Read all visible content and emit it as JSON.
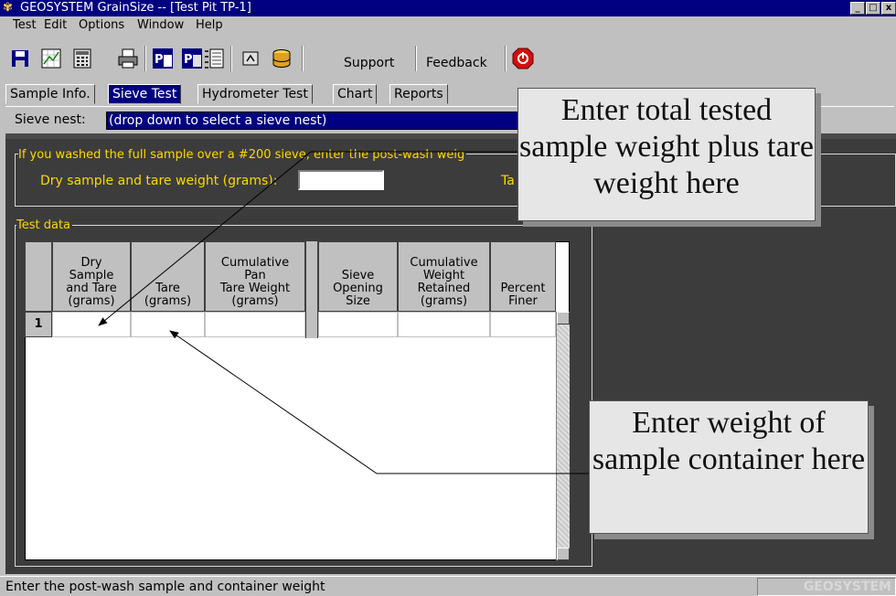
{
  "window": {
    "title": "GEOSYSTEM GrainSize -- [Test Pit TP-1]",
    "controls": [
      "_",
      "□",
      "x"
    ]
  },
  "menu": [
    {
      "label": "Test"
    },
    {
      "label": "Edit"
    },
    {
      "label": "Options"
    },
    {
      "label": "Window"
    },
    {
      "label": "Help"
    }
  ],
  "toolbar": {
    "icons": [
      "save-icon",
      "chart-icon",
      "calculator-icon",
      "printer-icon",
      "report-icon",
      "report-alt-icon",
      "sieve-icon",
      "edit-icon",
      "database-icon"
    ],
    "support_label": "Support",
    "feedback_label": "Feedback",
    "exit_icon": "stop-icon"
  },
  "tabs": [
    {
      "label": "Sample Info.",
      "active": false
    },
    {
      "label": "Sieve Test",
      "active": true
    },
    {
      "label": "Hydrometer Test",
      "active": false
    },
    {
      "label": "Chart",
      "active": false
    },
    {
      "label": "Reports",
      "active": false
    }
  ],
  "sieve_nest": {
    "label": "Sieve nest:",
    "value": "(drop down to select a sieve nest)"
  },
  "wash": {
    "prompt": "If you washed the full sample over a #200 sieve, enter the post-wash weig",
    "dry_label": "Dry sample and tare weight (grams):",
    "dry_value": "",
    "tare_label_partial": "Ta"
  },
  "test_data": {
    "group_label": "Test data",
    "left_headers": [
      "Dry\nSample\nand Tare\n(grams)",
      "Tare\n(grams)",
      "Cumulative\nPan\nTare Weight\n(grams)"
    ],
    "right_headers": [
      "Sieve\nOpening\nSize",
      "Cumulative\nWeight\nRetained\n(grams)",
      "Percent\nFiner"
    ],
    "rows": [
      {
        "num": "1",
        "cells": [
          "",
          "",
          "",
          "",
          "",
          ""
        ]
      }
    ]
  },
  "callouts": {
    "top": "Enter total tested sample weight plus tare weight here",
    "bottom": "Enter weight of sample container here"
  },
  "status": {
    "message": "Enter the post-wash sample and container weight",
    "brand": "GEOSYSTEM"
  },
  "colors": {
    "titlebar": "#000080",
    "workspace": "#3c3c3c",
    "prompt_text": "#ffd800",
    "face": "#c0c0c0"
  }
}
